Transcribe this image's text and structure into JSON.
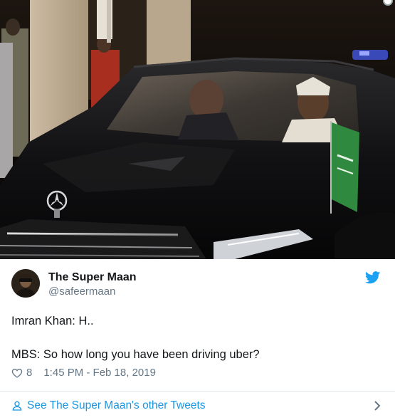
{
  "tweet": {
    "author_name": "The Super Maan",
    "author_handle": "@safeermaan",
    "text_line1": "Imran Khan: H..",
    "text_line2": "MBS: So how long you have been driving uber?",
    "likes": "8",
    "timestamp": "1:45 PM - Feb 18, 2019"
  },
  "footer": {
    "link_text": "See The Super Maan's other Tweets"
  },
  "icons": {
    "brand": "twitter-bird-icon",
    "like": "heart-icon",
    "profile": "person-icon",
    "more": "chevron-right-icon"
  },
  "colors": {
    "link_blue": "#1b95e0",
    "secondary_text": "#657786",
    "primary_text": "#14171a"
  }
}
